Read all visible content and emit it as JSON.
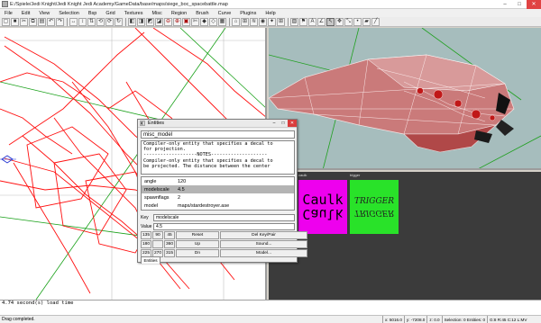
{
  "window": {
    "title": "E:/Spiele/Jedi Knight/Jedi Knight Jedi Academy/GameData/base/maps/siege_boc_spacebattle.map"
  },
  "menu": [
    "File",
    "Edit",
    "View",
    "Selection",
    "Bsp",
    "Grid",
    "Textures",
    "Misc",
    "Region",
    "Brush",
    "Curve",
    "Plugins",
    "Help"
  ],
  "toolbar": {
    "icons": [
      "open-icon",
      "save-icon",
      "cut-icon",
      "copy-icon",
      "paste-icon",
      "undo-icon",
      "redo-icon",
      "flip-x-icon",
      "flip-y-icon",
      "flip-z-icon",
      "rotate-x-icon",
      "rotate-y-icon",
      "rotate-z-icon",
      "select-complete-icon",
      "select-touching-icon",
      "select-partial-icon",
      "select-inside-icon",
      "csg-subtract-icon",
      "csg-merge-icon",
      "hollow-icon",
      "clipper-icon",
      "make-detail-icon",
      "make-structural-icon",
      "texture-lock-icon",
      "camera-icon",
      "cubic-clip-icon",
      "patch-icon",
      "entity-icon",
      "light-icon",
      "grid-icon",
      "texture-icon",
      "filter-icon",
      "show-names-icon",
      "show-angles-icon",
      "select-icon",
      "drag-icon",
      "resize-icon",
      "vertex-icon",
      "face-icon",
      "edge-icon"
    ],
    "glyphs": [
      "▢",
      "■",
      "✂",
      "⧉",
      "▤",
      "↶",
      "↷",
      "↔",
      "↕",
      "⇅",
      "⟲",
      "⟳",
      "↻",
      "◧",
      "◨",
      "◩",
      "◪",
      "⊖",
      "⊕",
      "▣",
      "✄",
      "◆",
      "◇",
      "▦",
      "⌂",
      "⊞",
      "≋",
      "◉",
      "✦",
      "⊞",
      "▧",
      "⚑",
      "A",
      "∠",
      "↖",
      "✥",
      "⤡",
      "•",
      "▰",
      "╱"
    ],
    "active_index": 34,
    "colors": {
      "highlight": "#a80000"
    }
  },
  "viewports": {
    "xy_label": "",
    "texture_label_caulk": "caulk",
    "texture_label_trigger": "trigger"
  },
  "textures": {
    "caulk_text": "Caulk",
    "trigger_text": "TRIGGER",
    "caulk_color": "#ee00ee",
    "trigger_color": "#29e229"
  },
  "entities": {
    "title": "Entities",
    "class": "misc_model",
    "description": "Compiler-only entity that specifies a decal to\nfor projection.\n-------------------NOTES--------------------\nCompiler-only entity that specifies a decal to\nbe projected. The distance between the center",
    "properties": [
      {
        "key": "angle",
        "value": "120"
      },
      {
        "key": "modelscale",
        "value": "4.5"
      },
      {
        "key": "spawnflags",
        "value": "2"
      },
      {
        "key": "model",
        "value": "maps/stardestroyer.ase"
      }
    ],
    "selected_property": 1,
    "key_label": "Key",
    "key_value": "modelscale",
    "value_label": "Value",
    "value_value": "4.5",
    "angles": [
      "135",
      "90",
      "45",
      "180",
      "360",
      "225",
      "270",
      "315"
    ],
    "buttons": {
      "reset": "Reset",
      "del": "Del Key/Pair",
      "up": "Up",
      "sound": "Sound...",
      "dn": "Dn",
      "model": "Model..."
    },
    "tab": "Entities"
  },
  "console": {
    "lines": [
      "4.74 second(s) load time"
    ]
  },
  "status": {
    "message": "Drag completed.",
    "cells": [
      "x: 5016.0",
      "y: -7208.0",
      "z: 0.0",
      "Selection: 0 Entities: 0",
      "G:8 R:45 C:12 L:MV"
    ]
  }
}
